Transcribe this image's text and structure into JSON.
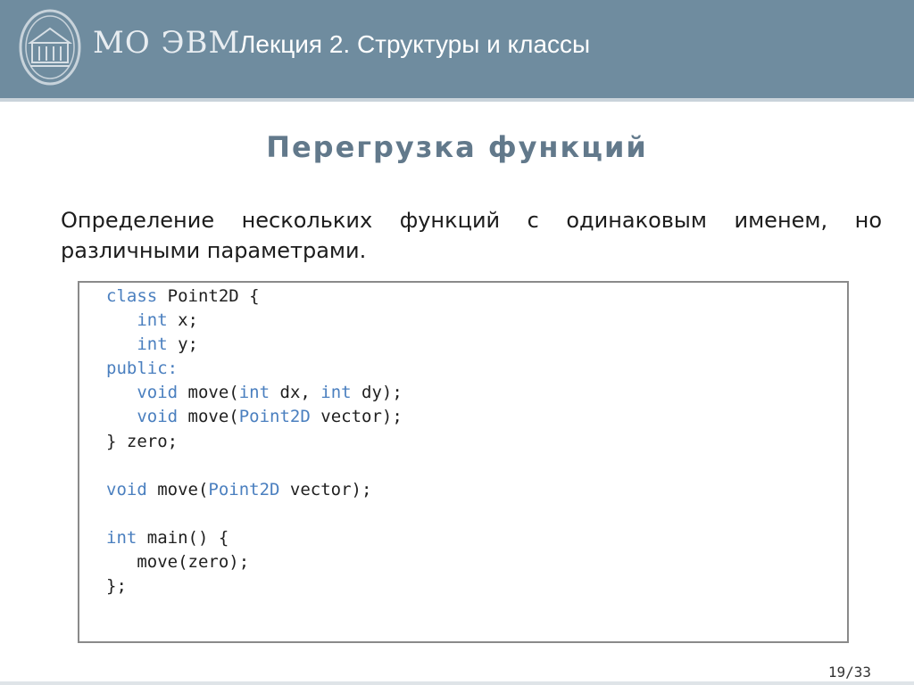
{
  "header": {
    "logo_text": "МО ЭВМ",
    "lecture_title": "Лекция 2.  Структуры и классы",
    "logo_icon": "university-seal-icon"
  },
  "slide": {
    "heading": "Перегрузка функций",
    "definition": "Определение нескольких функций с одинаковым именем, но различными параметрами.",
    "page_number": "19/33"
  },
  "code": {
    "lines": [
      [
        {
          "t": "class",
          "k": 1
        },
        {
          "t": " Point2D {"
        }
      ],
      [
        {
          "t": "   "
        },
        {
          "t": "int",
          "k": 1
        },
        {
          "t": " x;"
        }
      ],
      [
        {
          "t": "   "
        },
        {
          "t": "int",
          "k": 1
        },
        {
          "t": " y;"
        }
      ],
      [
        {
          "t": "public:",
          "k": 1
        }
      ],
      [
        {
          "t": "   "
        },
        {
          "t": "void",
          "k": 1
        },
        {
          "t": " move("
        },
        {
          "t": "int",
          "k": 1
        },
        {
          "t": " dx, "
        },
        {
          "t": "int",
          "k": 1
        },
        {
          "t": " dy);"
        }
      ],
      [
        {
          "t": "   "
        },
        {
          "t": "void",
          "k": 1
        },
        {
          "t": " move("
        },
        {
          "t": "Point2D",
          "k": 1
        },
        {
          "t": " vector);"
        }
      ],
      [
        {
          "t": "} zero;"
        }
      ],
      [],
      [
        {
          "t": "void",
          "k": 1
        },
        {
          "t": " move("
        },
        {
          "t": "Point2D",
          "k": 1
        },
        {
          "t": " vector);"
        }
      ],
      [],
      [
        {
          "t": "int",
          "k": 1
        },
        {
          "t": " main() {"
        }
      ],
      [
        {
          "t": "   move(zero);"
        }
      ],
      [
        {
          "t": "};"
        }
      ]
    ]
  },
  "colors": {
    "header_bg": "#6f8c9f",
    "heading": "#62798b",
    "keyword": "#4a7fbf"
  }
}
